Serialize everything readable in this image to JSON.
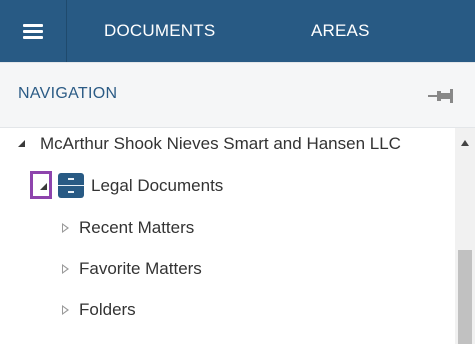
{
  "header": {
    "menu_icon": "hamburger-menu-icon",
    "tabs": [
      {
        "label": "DOCUMENTS"
      },
      {
        "label": "AREAS"
      }
    ]
  },
  "navigation": {
    "title": "NAVIGATION",
    "pin_icon": "pin-icon"
  },
  "tree": {
    "root": {
      "label": "McArthur Shook Nieves Smart and Hansen LLC",
      "expanded": true
    },
    "cabinet": {
      "label": "Legal Documents",
      "expanded": true,
      "icon": "file-cabinet-icon"
    },
    "children": [
      {
        "label": "Recent Matters",
        "expanded": false
      },
      {
        "label": "Favorite Matters",
        "expanded": false
      },
      {
        "label": "Folders",
        "expanded": false
      }
    ]
  },
  "colors": {
    "header_bg": "#285a84",
    "accent_text": "#2b5b85",
    "highlight": "#8e44ad"
  }
}
